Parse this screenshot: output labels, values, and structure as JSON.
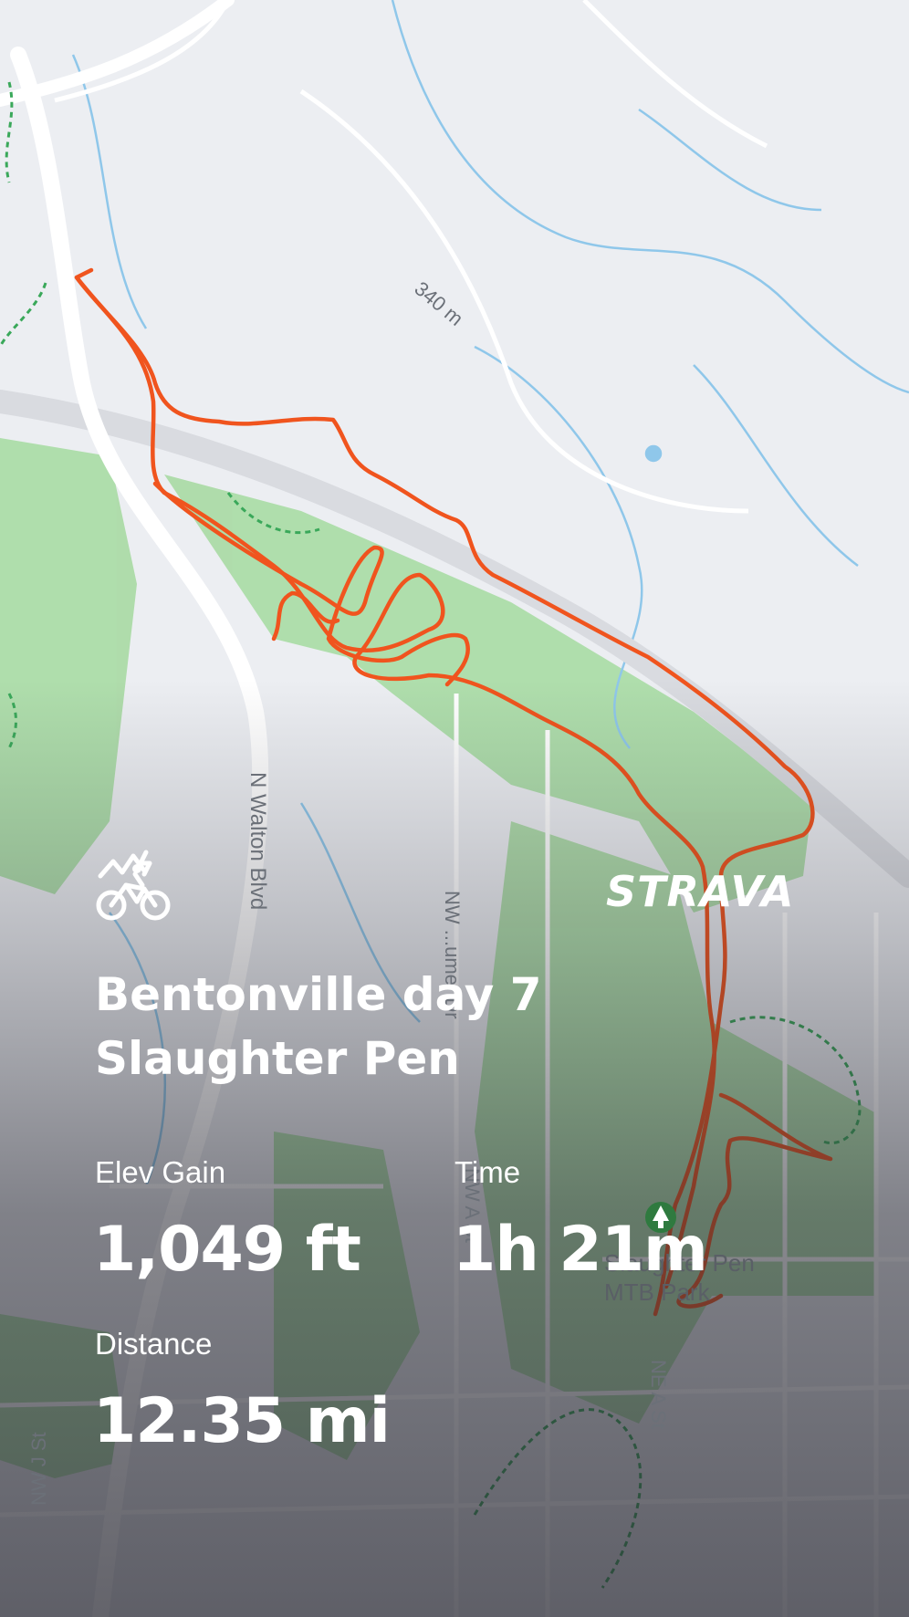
{
  "activity": {
    "type_icon": "mountain-bike-icon",
    "title_line1": "Bentonville day 7",
    "title_line2": "Slaughter Pen",
    "brand": "STRAVA"
  },
  "stats": {
    "elev_gain": {
      "label": "Elev Gain",
      "value": "1,049 ft"
    },
    "time": {
      "label": "Time",
      "value": "1h 21m"
    },
    "distance": {
      "label": "Distance",
      "value": "12.35 mi"
    }
  },
  "map": {
    "elevation_label": "340 m",
    "roads": [
      "N Walton Blvd",
      "NW Prairie / NW ...umer Dr",
      "NW A St",
      "NE A St",
      "NW J St"
    ],
    "road_labels": {
      "walton": "N Walton Blvd",
      "umer": "NW ...umer Dr",
      "nw_a": "NW A St",
      "ne_a": "NE A St",
      "nw_j": "NW J St"
    },
    "park_name_line1": "Slaughter Pen",
    "park_name_line2": "MTB Park",
    "park_icon": "tree-park-icon",
    "colors": {
      "route": "#f0541e",
      "park": "#a9dba4",
      "highway": "#d9dbe0",
      "water": "#8fc7ea"
    }
  }
}
